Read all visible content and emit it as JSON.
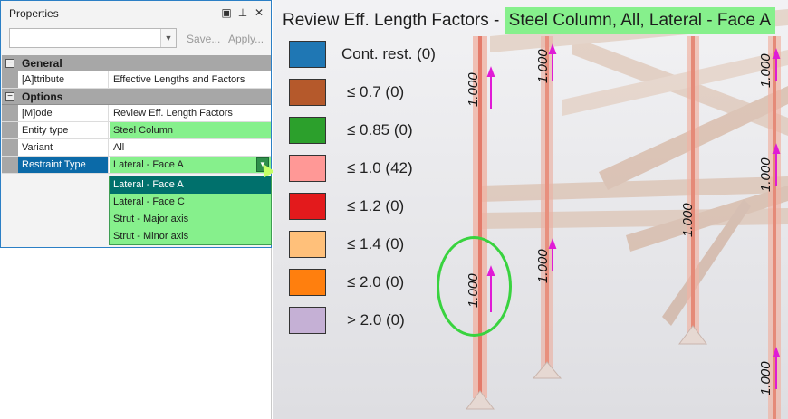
{
  "panel": {
    "title": "Properties",
    "title_buttons": [
      "▣",
      "⊥",
      "✕"
    ],
    "toolbar": {
      "combo_value": "",
      "save_label": "Save...",
      "apply_label": "Apply..."
    },
    "categories": {
      "general": {
        "label": "General",
        "toggle": "−"
      },
      "options": {
        "label": "Options",
        "toggle": "−"
      }
    },
    "rows": {
      "attribute": {
        "name": "[A]ttribute",
        "value": "Effective Lengths and Factors"
      },
      "mode": {
        "name": "[M]ode",
        "value": "Review Eff. Length Factors"
      },
      "entity_type": {
        "name": "Entity type",
        "value": "Steel Column"
      },
      "variant": {
        "name": "Variant",
        "value": "All"
      },
      "restraint_type": {
        "name": "Restraint Type",
        "value": "Lateral - Face A"
      }
    },
    "dropdown_options": [
      "Lateral - Face A",
      "Lateral - Face C",
      "Strut - Major axis",
      "Strut - Minor axis"
    ],
    "selected_option": "Lateral - Face A"
  },
  "view": {
    "title_prefix": "Review Eff. Length Factors -",
    "title_highlight": "Steel Column, All, Lateral - Face A",
    "legend": [
      {
        "label": "Cont. rest. (0)",
        "color": "#1f77b4"
      },
      {
        "label": "≤ 0.7 (0)",
        "color": "#b5592b"
      },
      {
        "label": "≤ 0.85 (0)",
        "color": "#2ca02c"
      },
      {
        "label": "≤ 1.0 (42)",
        "color": "#ff9896"
      },
      {
        "label": "≤ 1.2 (0)",
        "color": "#e31a1c"
      },
      {
        "label": "≤ 1.4 (0)",
        "color": "#ffc07a"
      },
      {
        "label": "≤ 2.0 (0)",
        "color": "#ff7f0e"
      },
      {
        "label": "> 2.0 (0)",
        "color": "#c5b0d5"
      }
    ],
    "factor_labels": [
      "1.000",
      "1.000",
      "1.000",
      "1.000",
      "1.000",
      "1.000",
      "1.000",
      "1.000"
    ]
  }
}
